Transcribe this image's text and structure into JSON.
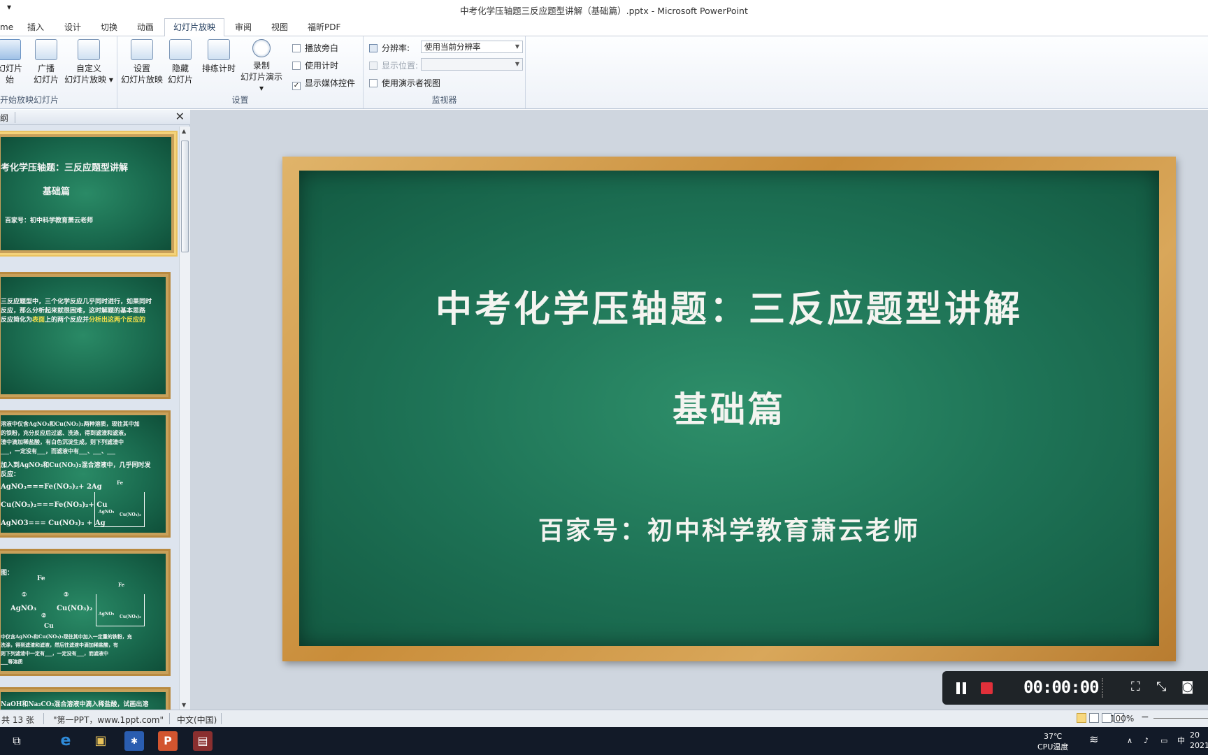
{
  "window": {
    "qat_glyph": "▾",
    "title": "中考化学压轴题三反应题型讲解（基础篇）.pptx - Microsoft PowerPoint"
  },
  "tabs": [
    {
      "label": "me"
    },
    {
      "label": "插入"
    },
    {
      "label": "设计"
    },
    {
      "label": "切换"
    },
    {
      "label": "动画"
    },
    {
      "label": "幻灯片放映",
      "active": true
    },
    {
      "label": "审阅"
    },
    {
      "label": "视图"
    },
    {
      "label": "福昕PDF"
    }
  ],
  "ribbon": {
    "start_group": {
      "label": "开始放映幻灯片",
      "from_current_line1": "幻灯片",
      "from_current_line2": "始",
      "broadcast_line1": "广播",
      "broadcast_line2": "幻灯片",
      "custom_line1": "自定义",
      "custom_line2": "幻灯片放映 ▾"
    },
    "setup_group": {
      "label": "设置",
      "setup_line1": "设置",
      "setup_line2": "幻灯片放映",
      "hide_line1": "隐藏",
      "hide_line2": "幻灯片",
      "rehearse": "排练计时",
      "record_line1": "录制",
      "record_line2": "幻灯片演示 ▾",
      "play_narration": "播放旁白",
      "use_timings": "使用计时",
      "show_media_controls": "显示媒体控件",
      "play_narration_checked": false,
      "use_timings_checked": false,
      "show_media_controls_checked": true
    },
    "monitors_group": {
      "label": "监视器",
      "resolution_label": "分辨率:",
      "resolution_value": "使用当前分辨率",
      "show_on_label": "显示位置:",
      "show_on_value": "",
      "presenter_view": "使用演示者视图",
      "presenter_view_checked": false
    }
  },
  "left_panel": {
    "tab_label": "纲",
    "close_glyph": "✕",
    "thumbnails": [
      {
        "lines": [
          "考化学压轴题：三反应题型讲解",
          "基础篇",
          "百家号：初中科学教育萧云老师"
        ]
      },
      {
        "lines": [
          "三反应题型中，三个化学反应几乎同时进行，如果同时",
          "反应，那么分析起来就很困难，这时解题的基本思路",
          "反应简化为",
          "表面",
          "上的两个反应并",
          "分析出这两个反应的"
        ]
      },
      {
        "lines": [
          "溶液中仅含AgNO₃和Cu(NO₃)₂两种溶质，现往其中加",
          "的铁粉，充分反应后过滤、洗涤，得到滤渣和滤液。",
          "渣中滴加稀盐酸，有白色沉淀生成，则下列滤渣中",
          "___，一定没有___，而滤液中有___、___、___",
          "加入到AgNO₃和Cu(NO₃)₂混合溶液中，几乎同时发",
          "反应：",
          "AgNO₃===Fe(NO₃)₂+ 2Ag",
          "Cu(NO₃)₂===Fe(NO₃)₂+ Cu",
          "AgNO3=== Cu(NO₃)₂ + Ag",
          "Fe",
          "AgNO₃",
          "Cu(NO₃)₂"
        ]
      },
      {
        "lines": [
          "图：",
          "Fe",
          "①",
          "③",
          "AgNO₃",
          "Cu(NO₃)₂",
          "②",
          "Cu",
          "Fe",
          "AgNO₃",
          "Cu(NO₃)₂",
          "中仅含AgNO₃和Cu(NO₃)₂现往其中加入一定量的铁粉，充",
          "洗涤，得到滤渣和滤液，然后往滤液中滴加稀盐酸，有",
          "则下列滤渣中一定有___，一定没有___，而滤液中",
          "___等溶质"
        ]
      },
      {
        "lines": [
          "NaOH和Na₂CO₃混合溶液中滴入稀盐酸，试画出溶"
        ]
      }
    ]
  },
  "slide": {
    "title": "中考化学压轴题：三反应题型讲解",
    "subtitle": "基础篇",
    "author": "百家号：初中科学教育萧云老师"
  },
  "recorder": {
    "time": "00:00:00"
  },
  "status_bar": {
    "slide_count": "共 13 张",
    "theme": "\"第一PPT，www.1ppt.com\"",
    "language": "中文(中国)",
    "zoom": "100%",
    "zoom_minus": "−"
  },
  "taskbar": {
    "temp": "37℃",
    "temp_label": "CPU温度",
    "ime": "中",
    "clock_top": "20",
    "clock_bottom": "2021",
    "wifi_glyph": "≋",
    "chevron_glyph": "∧",
    "mic_glyph": "♪",
    "monitor_glyph": "▭",
    "notify_glyph": "▤"
  }
}
